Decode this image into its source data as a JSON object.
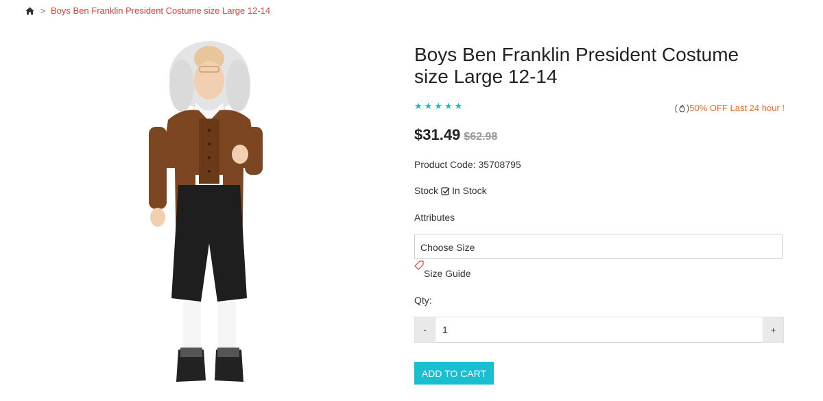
{
  "breadcrumb": {
    "home_icon": "home-icon",
    "separator": ">",
    "current": "Boys Ben Franklin President Costume size Large 12-14"
  },
  "product": {
    "title": "Boys Ben Franklin President Costume size Large 12-14",
    "rating": {
      "stars": 5,
      "icon": "star-icon",
      "color": "#17b8c9"
    },
    "promo": {
      "icon": "fire-icon",
      "text": "50% OFF Last 24 hour !",
      "color": "#ef6a2c"
    },
    "price": "$31.49",
    "old_price": "$62.98",
    "code_label": "Product Code:",
    "code_value": "35708795",
    "stock_label": "Stock",
    "stock_status": "In Stock",
    "attributes_label": "Attributes",
    "size_select_value": "Choose Size",
    "size_guide_label": "Size Guide",
    "qty_label": "Qty",
    "qty_colon": ":",
    "qty_minus": "-",
    "qty_value": "1",
    "qty_plus": "+",
    "add_to_cart_label": "ADD TO CART",
    "accent_color": "#17bfd0"
  }
}
